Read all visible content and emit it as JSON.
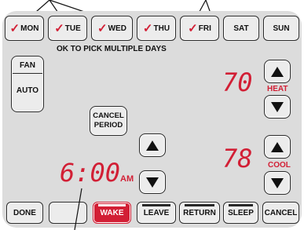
{
  "days": [
    {
      "label": "MON",
      "checked": true
    },
    {
      "label": "TUE",
      "checked": true
    },
    {
      "label": "WED",
      "checked": true
    },
    {
      "label": "THU",
      "checked": true
    },
    {
      "label": "FRI",
      "checked": true
    },
    {
      "label": "SAT",
      "checked": false
    },
    {
      "label": "SUN",
      "checked": false
    }
  ],
  "check_glyph": "✓",
  "hint": "OK TO PICK MULTIPLE DAYS",
  "fan": {
    "title": "FAN",
    "mode": "AUTO"
  },
  "cancel_period": {
    "line1": "CANCEL",
    "line2": "PERIOD"
  },
  "time": {
    "value": "6:00",
    "ampm": "AM"
  },
  "heat": {
    "value": "70",
    "label": "HEAT"
  },
  "cool": {
    "value": "78",
    "label": "COOL"
  },
  "periods": [
    "DONE",
    "",
    "WAKE",
    "LEAVE",
    "RETURN",
    "SLEEP",
    "CANCEL"
  ],
  "active_period": "WAKE",
  "colors": {
    "accent": "#d21f35",
    "panel": "#dcdcdc",
    "button": "#ececec"
  }
}
